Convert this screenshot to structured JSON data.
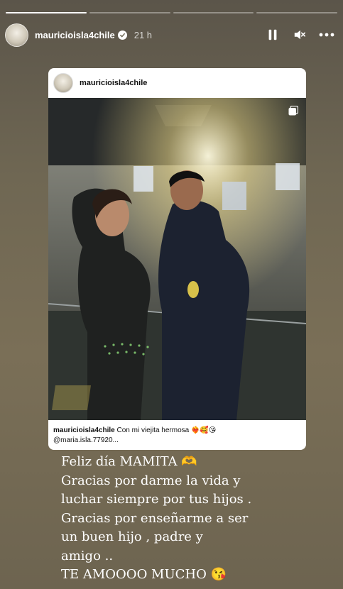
{
  "progress": [
    1,
    0,
    0,
    0
  ],
  "header": {
    "username": "mauricioisla4chile",
    "time": "21 h"
  },
  "controls": {
    "pause": "pause-icon",
    "mute": "speaker-muted-icon",
    "more": "more-icon"
  },
  "post": {
    "username": "mauricioisla4chile",
    "caption_user": "mauricioisla4chile",
    "caption_text": "Con mi viejita hermosa ❤️‍🔥🥰😘",
    "caption_mention": "@maria.isla.77920..."
  },
  "message": {
    "lines": [
      "Feliz día MAMITA 🫶",
      "Gracias por darme la vida y",
      "luchar siempre por tus hijos .",
      "Gracias por enseñarme a ser",
      "un buen hijo , padre y",
      "amigo ..",
      "TE AMOOOO MUCHO 😘"
    ]
  }
}
